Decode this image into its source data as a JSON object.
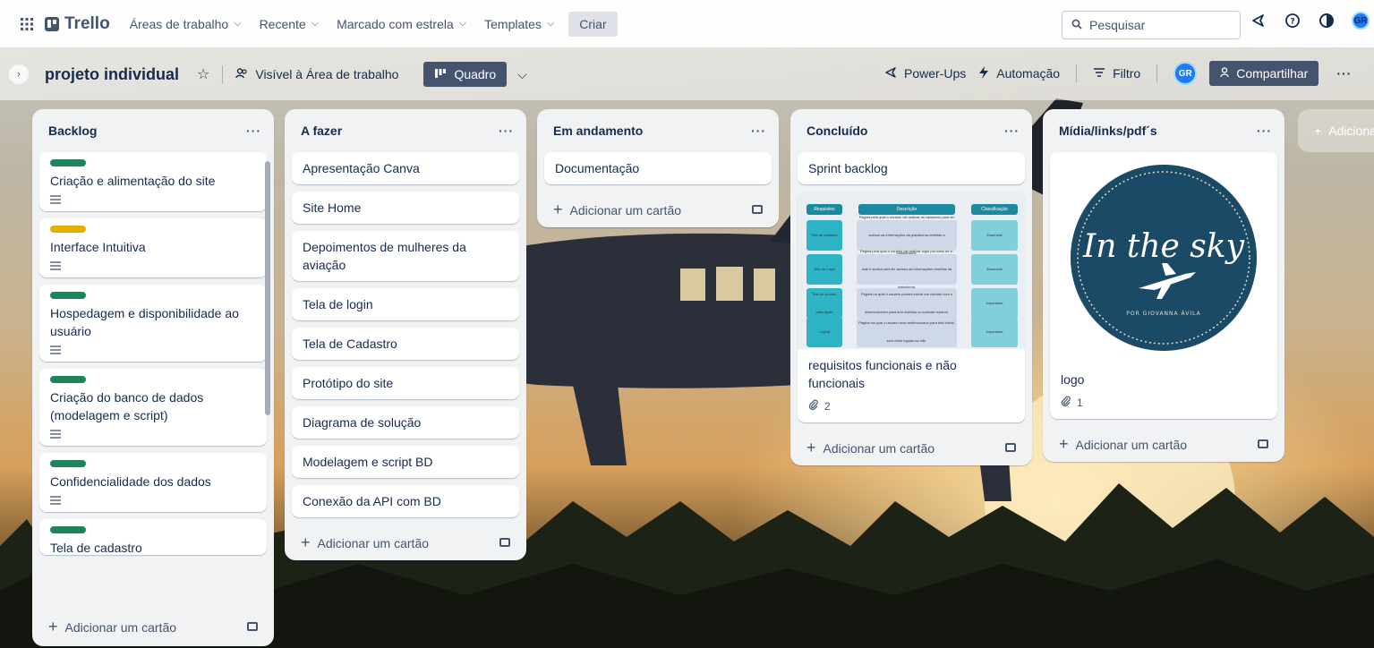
{
  "topbar": {
    "logo_text": "Trello",
    "nav": [
      {
        "label": "Áreas de trabalho"
      },
      {
        "label": "Recente"
      },
      {
        "label": "Marcado com estrela"
      },
      {
        "label": "Templates"
      }
    ],
    "create_label": "Criar",
    "search_placeholder": "Pesquisar",
    "avatar_initials": "GR"
  },
  "board": {
    "title": "projeto individual",
    "visibility": "Visível à Área de trabalho",
    "view": "Quadro",
    "powerups": "Power-Ups",
    "automation": "Automação",
    "filter": "Filtro",
    "member_initials": "GR",
    "share": "Compartilhar"
  },
  "add_card_label": "Adicionar um cartão",
  "add_list_label": "Adiciona",
  "lists": [
    {
      "title": "Backlog",
      "cards": [
        {
          "title": "Criação e alimentação do site",
          "label_color": "#1f845a",
          "has_desc": true
        },
        {
          "title": "Interface Intuitiva",
          "label_color": "#e2b203",
          "has_desc": true
        },
        {
          "title": "Hospedagem e disponibilidade ao usuário",
          "label_color": "#1f845a",
          "has_desc": true
        },
        {
          "title": "Criação do banco de dados (modelagem e script)",
          "label_color": "#1f845a",
          "has_desc": true
        },
        {
          "title": "Confidencialidade dos dados",
          "label_color": "#1f845a",
          "has_desc": true
        },
        {
          "title": "Tela de cadastro",
          "label_color": "#1f845a",
          "has_desc": false
        }
      ]
    },
    {
      "title": "A fazer",
      "cards": [
        {
          "title": "Apresentação Canva"
        },
        {
          "title": "Site Home"
        },
        {
          "title": "Depoimentos de mulheres da aviação"
        },
        {
          "title": "Tela de login"
        },
        {
          "title": "Tela de Cadastro"
        },
        {
          "title": "Protótipo do site"
        },
        {
          "title": "Diagrama de solução"
        },
        {
          "title": "Modelagem e script BD"
        },
        {
          "title": "Conexão da API com BD"
        }
      ]
    },
    {
      "title": "Em andamento",
      "cards": [
        {
          "title": "Documentação"
        }
      ]
    },
    {
      "title": "Concluído",
      "cards": [
        {
          "title": "Sprint backlog"
        },
        {
          "title": "requisitos funcionais e não funcionais",
          "attachments": "2"
        }
      ]
    },
    {
      "title": "Mídia/links/pdf´s",
      "cards": [
        {
          "title": "logo",
          "attachments": "1",
          "image_text": "In the sky",
          "image_subtext": "POR GIOVANNA ÁVILA"
        }
      ]
    }
  ],
  "req_table": {
    "headers": [
      "Requisitos",
      "Descrição",
      "Classificação"
    ],
    "rows": [
      [
        "Tela de cadastro",
        "Página pela qual o usuário vai realizar os cadastros para ter acesso as informações da plataforma restritas a cadastrados.",
        "Essencial"
      ],
      [
        "Tela de Login",
        "Página pela qual o usuário vai realizar login por meio de e-mail e senha para ter acesso as informações restritas da plataforma.",
        "Essencial"
      ],
      [
        "Tela de contato para ajuda",
        "Página na qual o usuário poderá entrar em contato com o desenvolvedor para tirar dúvidas ou solicitar reparos.",
        "Importante"
      ],
      [
        "Logout",
        "Página na qual o usuário será redirecionado para tela inicial, sem estar logado ao site.",
        "Importante"
      ]
    ]
  }
}
